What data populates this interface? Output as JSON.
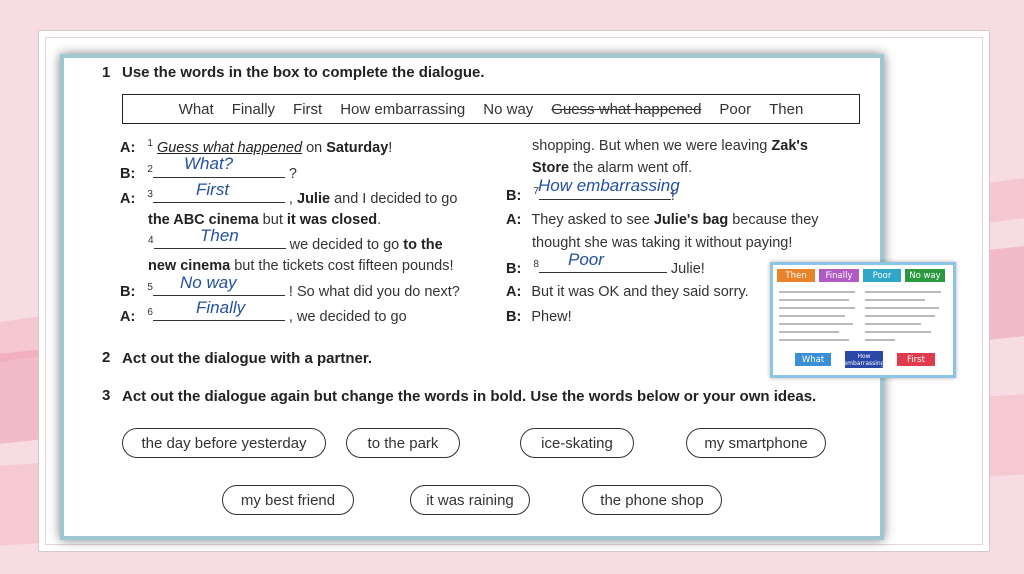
{
  "exercise1": {
    "number": "1",
    "instruction": "Use the words in the box to complete the dialogue.",
    "box_words": [
      {
        "text": "What",
        "struck": false
      },
      {
        "text": "Finally",
        "struck": false
      },
      {
        "text": "First",
        "struck": false
      },
      {
        "text": "How embarrassing",
        "struck": false
      },
      {
        "text": "No way",
        "struck": false
      },
      {
        "text": "Guess what happened",
        "struck": true
      },
      {
        "text": "Poor",
        "struck": false
      },
      {
        "text": "Then",
        "struck": false
      }
    ],
    "left": {
      "l1": {
        "spk": "A:",
        "sup": "1",
        "example": "Guess what happened",
        "t1": " on ",
        "b1": "Saturday",
        "t2": "!"
      },
      "l2": {
        "spk": "B:",
        "sup": "2",
        "answer": "What?",
        "t1": " ?"
      },
      "l3": {
        "spk": "A:",
        "sup": "3",
        "answer": "First",
        "t1": " , ",
        "b1": "Julie",
        "t2": " and I decided to go"
      },
      "l4": {
        "b1": "the ABC cinema",
        "t1": " but ",
        "b2": "it was closed",
        "t2": "."
      },
      "l5": {
        "sup": "4",
        "answer": "Then",
        "t1": " we decided to go ",
        "b1": "to the"
      },
      "l6": {
        "b1": "new cinema",
        "t1": " but the tickets cost fifteen pounds!"
      },
      "l7": {
        "spk": "B:",
        "sup": "5",
        "answer": "No way",
        "t1": " ! So what did you do next?"
      },
      "l8": {
        "spk": "A:",
        "sup": "6",
        "answer": "Finally",
        "t1": " , we decided to go"
      }
    },
    "right": {
      "r1": {
        "t1": "shopping. But when we were leaving ",
        "b1": "Zak's"
      },
      "r2": {
        "b1": "Store",
        "t1": " the alarm went off."
      },
      "r3": {
        "spk": "B:",
        "sup": "7",
        "answer": "How embarrassing",
        "t1": "!"
      },
      "r4": {
        "spk": "A:",
        "t1": "They asked to see ",
        "b1": "Julie's bag",
        "t2": " because they"
      },
      "r5": {
        "t1": "thought she was taking it without paying!"
      },
      "r6": {
        "spk": "B:",
        "sup": "8",
        "answer": "Poor",
        "t1": " Julie!"
      },
      "r7": {
        "spk": "A:",
        "t1": "But it was OK and they said sorry."
      },
      "r8": {
        "spk": "B:",
        "t1": "Phew!"
      }
    }
  },
  "exercise2": {
    "number": "2",
    "instruction": "Act out the dialogue with a partner."
  },
  "exercise3": {
    "number": "3",
    "instruction": "Act out the dialogue again but change the words in bold. Use the words below or your own ideas.",
    "options": [
      "the day before yesterday",
      "to the park",
      "ice-skating",
      "my smartphone",
      "my best friend",
      "it was raining",
      "the phone shop"
    ]
  },
  "thumbnail": {
    "top_chips": [
      {
        "label": "Then",
        "color": "#e8832a"
      },
      {
        "label": "Finally",
        "color": "#b05bc4"
      },
      {
        "label": "Poor",
        "color": "#2fa7c8"
      },
      {
        "label": "No way",
        "color": "#2b9a3f"
      }
    ],
    "bottom_chips": [
      {
        "label": "What",
        "color": "#3a8fd6"
      },
      {
        "label": "How embarrassing",
        "color": "#2b48a8"
      },
      {
        "label": "First",
        "color": "#e03b4d"
      }
    ]
  }
}
